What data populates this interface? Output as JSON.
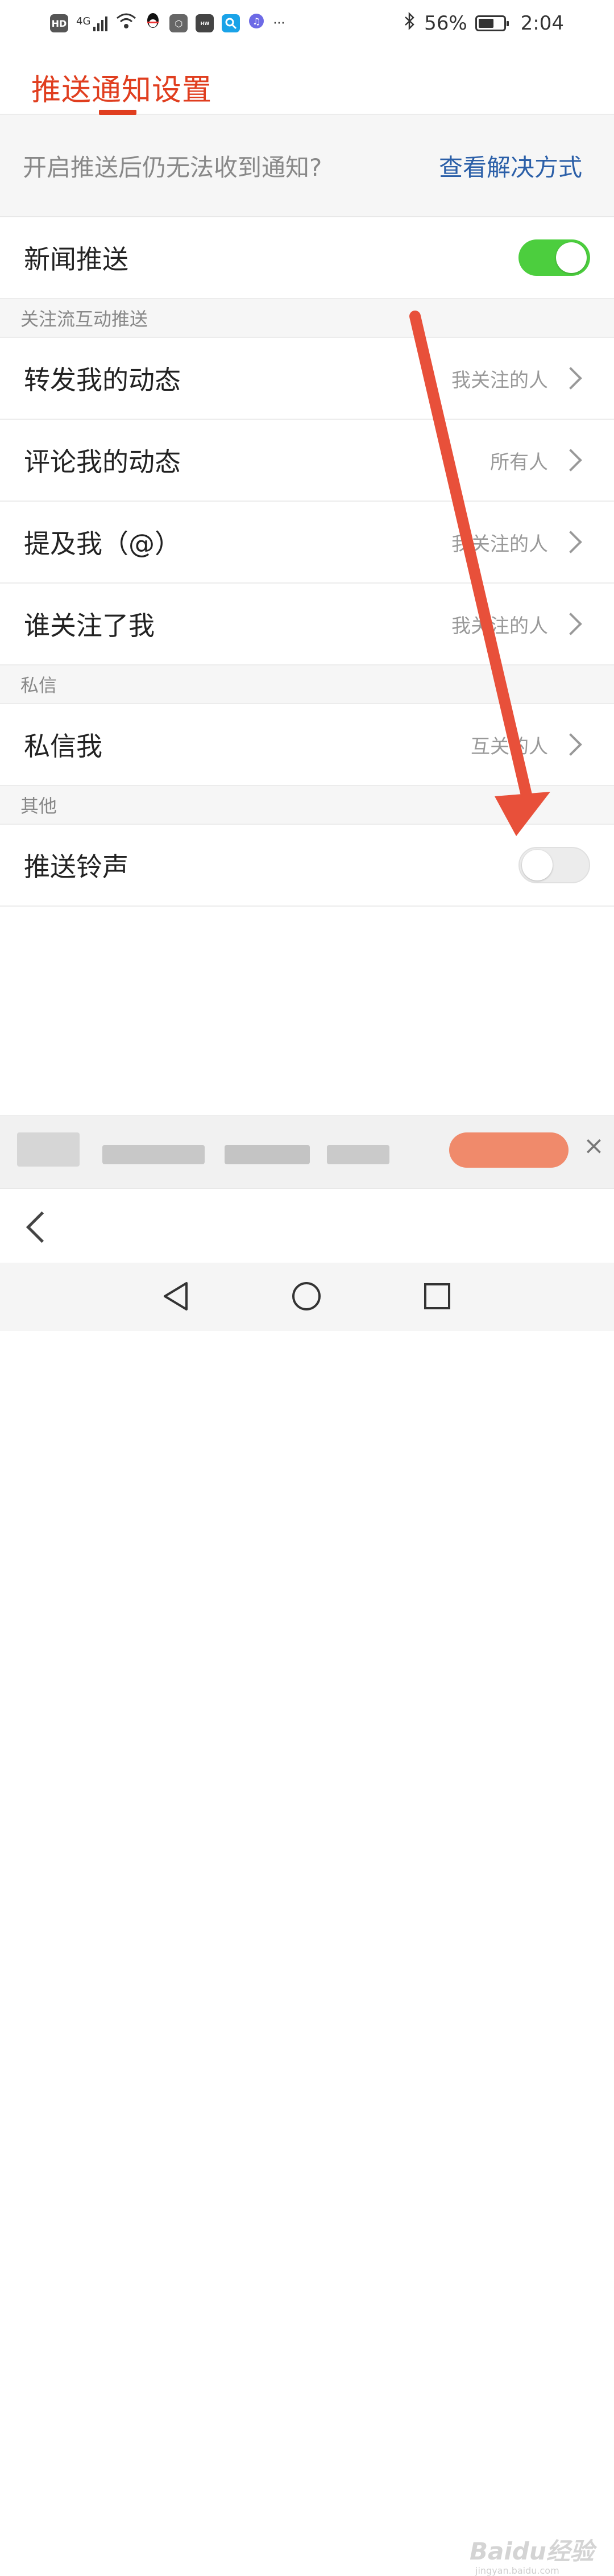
{
  "status_bar": {
    "network_label": "HD",
    "signal_label": "4G",
    "dots": "···",
    "battery_percent": "56%",
    "time": "2:04"
  },
  "header": {
    "title": "推送通知设置"
  },
  "hint": {
    "text": "开启推送后仍无法收到通知?",
    "link": "查看解决方式"
  },
  "news_push": {
    "label": "新闻推送",
    "enabled": true
  },
  "sections": {
    "interaction": "关注流互动推送",
    "private": "私信",
    "other": "其他"
  },
  "interaction_rows": [
    {
      "label": "转发我的动态",
      "value": "我关注的人"
    },
    {
      "label": "评论我的动态",
      "value": "所有人"
    },
    {
      "label": "提及我（@）",
      "value": "我关注的人"
    },
    {
      "label": "谁关注了我",
      "value": "我关注的人"
    }
  ],
  "private_rows": [
    {
      "label": "私信我",
      "value": "互关的人"
    }
  ],
  "ringtone": {
    "label": "推送铃声",
    "enabled": false
  },
  "ad": {
    "close": "×"
  },
  "nav": {
    "watermark": "Baidu经验",
    "watermark_sub": "jingyan.baidu.com"
  },
  "colors": {
    "accent": "#e03e1f",
    "link": "#2b5fa8",
    "toggle_on": "#4cce3e",
    "annotation_arrow": "#e8503a"
  }
}
